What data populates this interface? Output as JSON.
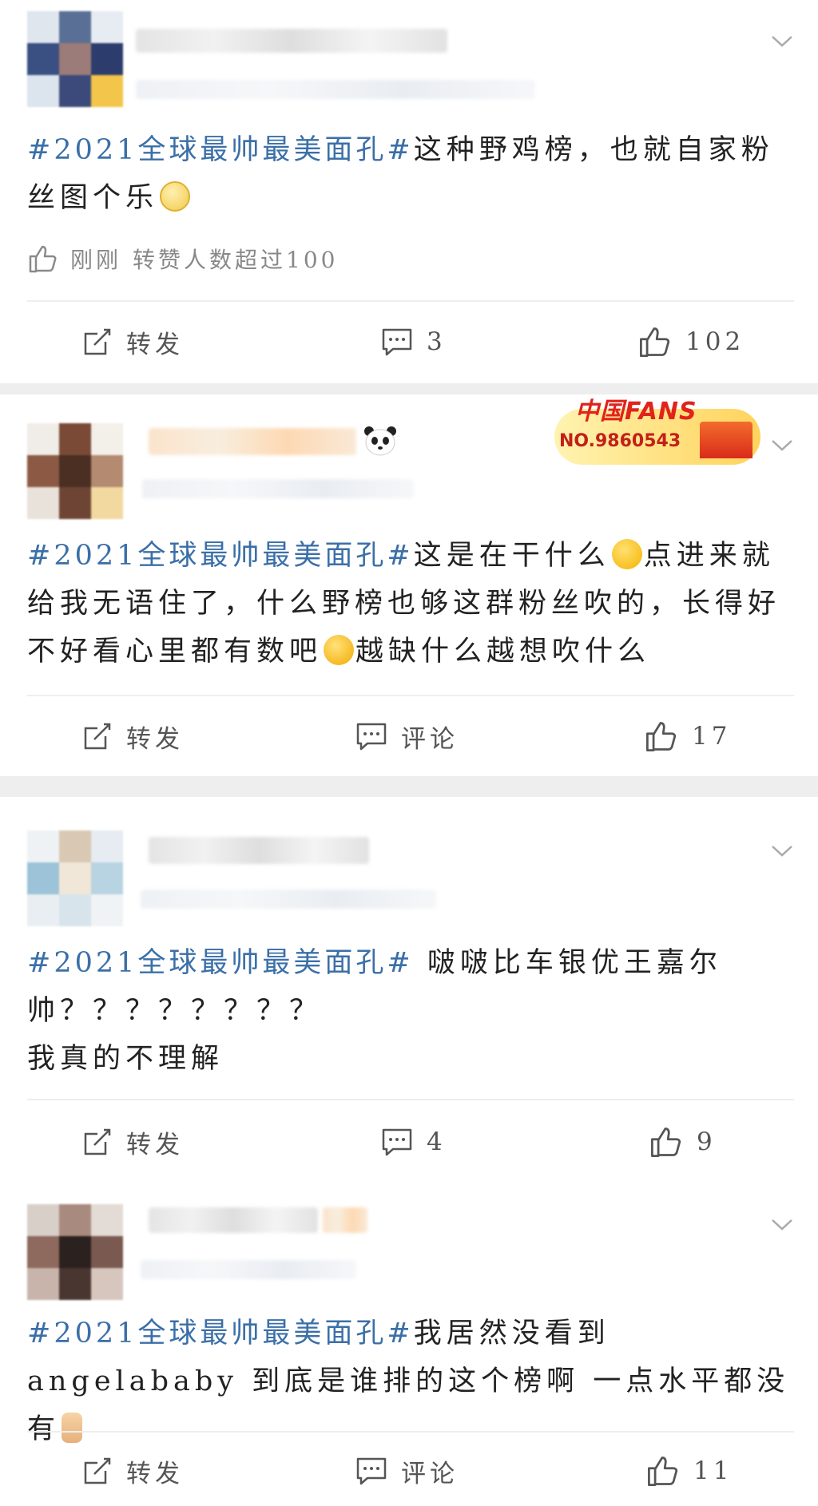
{
  "accent": "#3b6fa8",
  "posts": [
    {
      "hashtag": "#2021全球最帅最美面孔#",
      "text": "这种野鸡榜，也就自家粉丝图个乐",
      "emoji": "mask-emoji",
      "meta": {
        "time": "刚刚",
        "note": "转赞人数超过100"
      },
      "actions": {
        "repost": "转发",
        "comment": "3",
        "like": "102"
      }
    },
    {
      "hashtag": "#2021全球最帅最美面孔#",
      "text_a": "这是在干什么",
      "emoji_a": "sweat-smile-emoji",
      "text_b": "点进来就给我无语住了，什么野榜也够这群粉丝吹的，长得好不好看心里都有数吧",
      "emoji_b": "crying-emoji",
      "text_c": "越缺什么越想吹什么",
      "badge": {
        "brand": "中国FANS",
        "number": "NO.9860543"
      },
      "actions": {
        "repost": "转发",
        "comment": "评论",
        "like": "17"
      }
    },
    {
      "hashtag": "#2021全球最帅最美面孔#",
      "text_a": " 啵啵比车银优王嘉尔",
      "text_b": "帅？？？？？？？？",
      "text_c": "我真的不理解",
      "actions": {
        "repost": "转发",
        "comment": "4",
        "like": "9"
      }
    },
    {
      "hashtag": "#2021全球最帅最美面孔#",
      "text_a": "我居然没看到angelababy  到底是谁排的这个榜啊   一点水平都没有",
      "emoji": "thumbs-up-emoji",
      "actions": {
        "repost": "转发",
        "comment": "评论",
        "like": "11"
      }
    }
  ]
}
